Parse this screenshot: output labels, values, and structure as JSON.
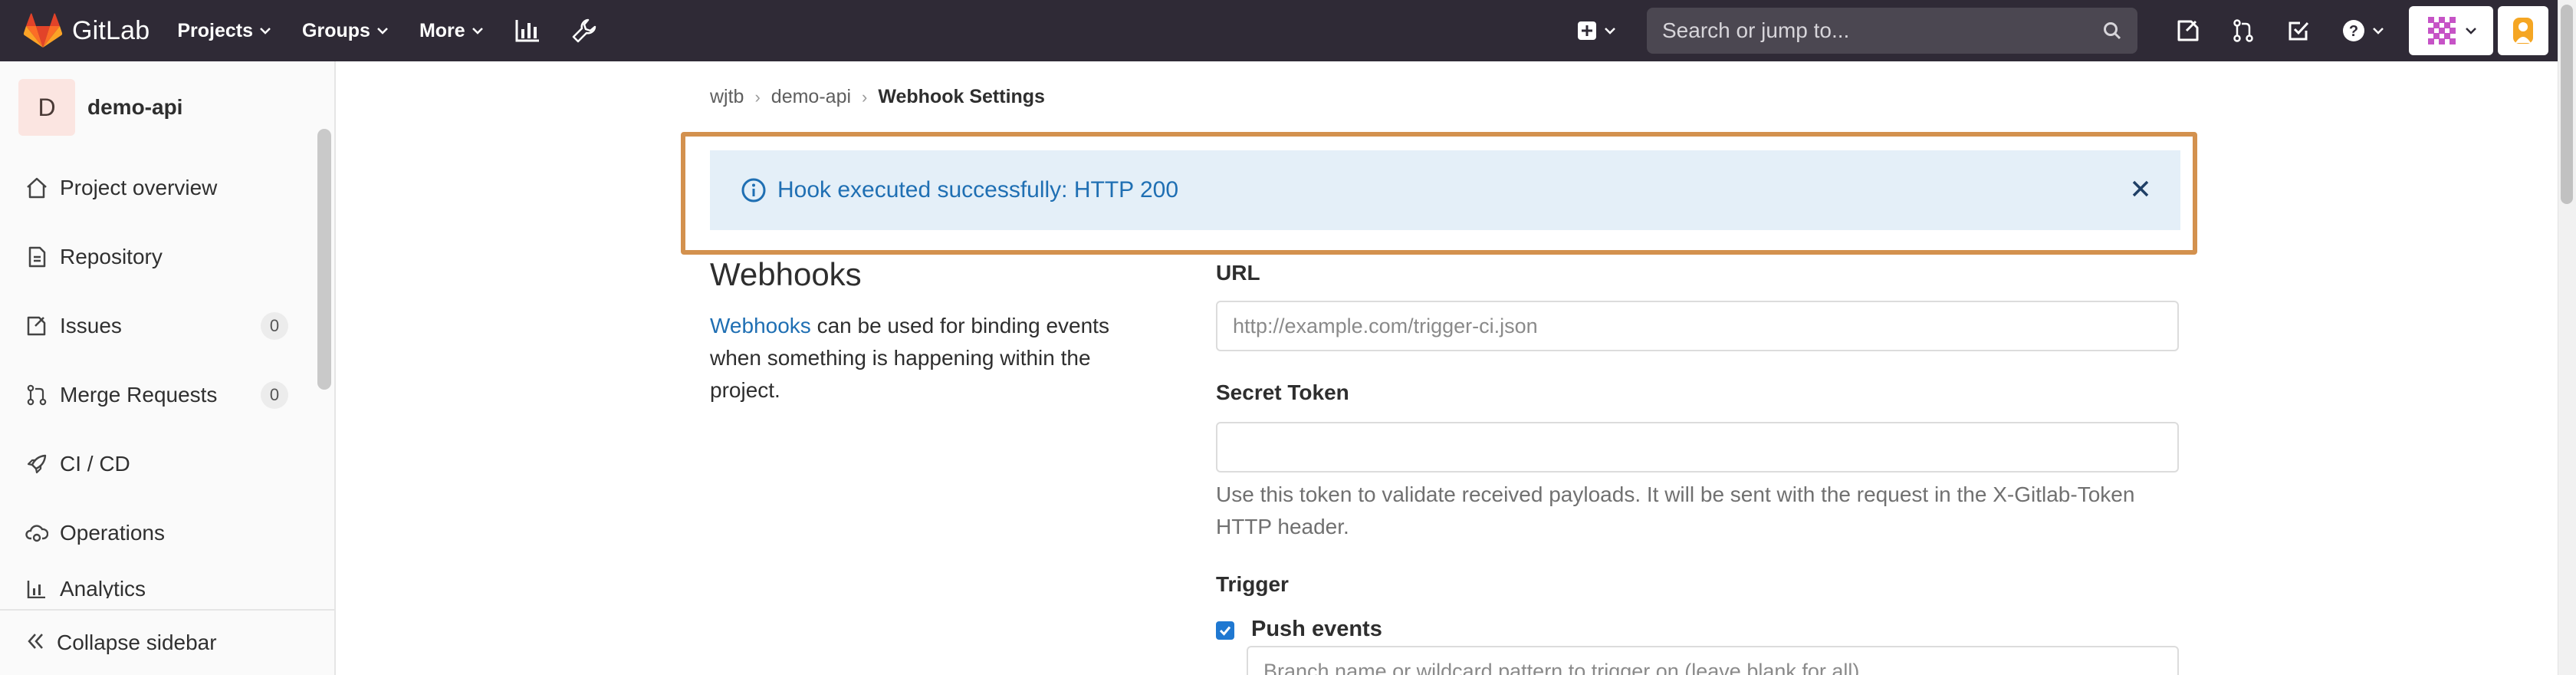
{
  "nav": {
    "brand": "GitLab",
    "menus": [
      {
        "label": "Projects"
      },
      {
        "label": "Groups"
      },
      {
        "label": "More"
      }
    ],
    "search_placeholder": "Search or jump to..."
  },
  "sidebar": {
    "project_initial": "D",
    "project_name": "demo-api",
    "items": [
      {
        "label": "Project overview",
        "icon": "home-icon"
      },
      {
        "label": "Repository",
        "icon": "doc-icon"
      },
      {
        "label": "Issues",
        "icon": "issues-icon",
        "count": "0"
      },
      {
        "label": "Merge Requests",
        "icon": "merge-request-icon",
        "count": "0"
      },
      {
        "label": "CI / CD",
        "icon": "rocket-icon"
      },
      {
        "label": "Operations",
        "icon": "cloud-gear-icon"
      },
      {
        "label": "Analytics",
        "icon": "chart-icon"
      }
    ],
    "collapse_label": "Collapse sidebar"
  },
  "breadcrumb": [
    "wjtb",
    "demo-api",
    "Webhook Settings"
  ],
  "flash": {
    "message": "Hook executed successfully: HTTP 200",
    "color": "#1f6fb3",
    "background": "#e4eff8"
  },
  "webhooks": {
    "title": "Webhooks",
    "desc_link": "Webhooks",
    "desc_text": " can be used for binding events when something is happening within the project."
  },
  "form": {
    "url_label": "URL",
    "url_placeholder": "http://example.com/trigger-ci.json",
    "url_value": "",
    "token_label": "Secret Token",
    "token_value": "",
    "token_help": "Use this token to validate received payloads. It will be sent with the request in the X-Gitlab-Token HTTP header.",
    "trigger_label": "Trigger",
    "push_events_label": "Push events",
    "push_events_checked": true,
    "branch_placeholder": "Branch name or wildcard pattern to trigger on (leave blank for all)"
  },
  "colors": {
    "nav_bg": "#2f2a36",
    "link": "#1f6fb3",
    "highlight_border": "#d3914e"
  }
}
